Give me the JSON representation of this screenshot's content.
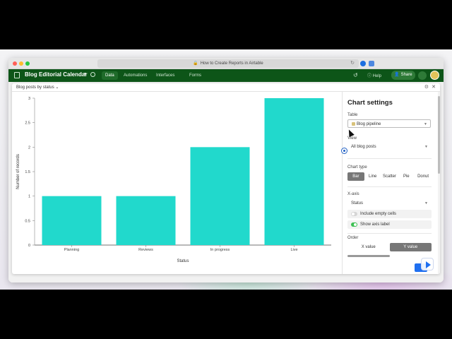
{
  "browser": {
    "url_title": "How to Create Reports in Airtable",
    "reload_icon": "reload-icon",
    "lock_icon": "lock-icon"
  },
  "app": {
    "base_title": "Blog Editorial Calendar",
    "nav": [
      "Data",
      "Automations",
      "Interfaces",
      "Forms"
    ],
    "active_nav": "Data",
    "help_label": "Help",
    "share_label": "Share"
  },
  "modal": {
    "chart_name": "Blog posts by status"
  },
  "chart_data": {
    "type": "bar",
    "categories": [
      "Planning",
      "Reviews",
      "In progress",
      "Live"
    ],
    "values": [
      1,
      1,
      2,
      3
    ],
    "xlabel": "Status",
    "ylabel": "Number of records",
    "ylim": [
      0,
      3
    ],
    "yticks": [
      0,
      0.5,
      1,
      1.5,
      2,
      2.5,
      3
    ],
    "ytick_labels": [
      "0",
      "0.5",
      "1",
      "1.5",
      "2",
      "2.5",
      "3"
    ],
    "bar_color": "#21d9cc",
    "grid": false
  },
  "settings": {
    "title": "Chart settings",
    "table_label": "Table",
    "table_value": "Blog pipeline",
    "view_label": "View",
    "view_value": "All blog posts",
    "chart_type_label": "Chart type",
    "chart_types": [
      "Bar",
      "Line",
      "Scatter",
      "Pie",
      "Donut"
    ],
    "chart_type_selected": "Bar",
    "xaxis_label": "X-axis",
    "xaxis_value": "Status",
    "include_empty": "Include empty cells",
    "include_empty_on": false,
    "show_axis_label": "Show axis label",
    "show_axis_label_on": true,
    "order_label": "Order",
    "order_options": [
      "X value",
      "Y value"
    ],
    "order_selected": "Y value"
  }
}
